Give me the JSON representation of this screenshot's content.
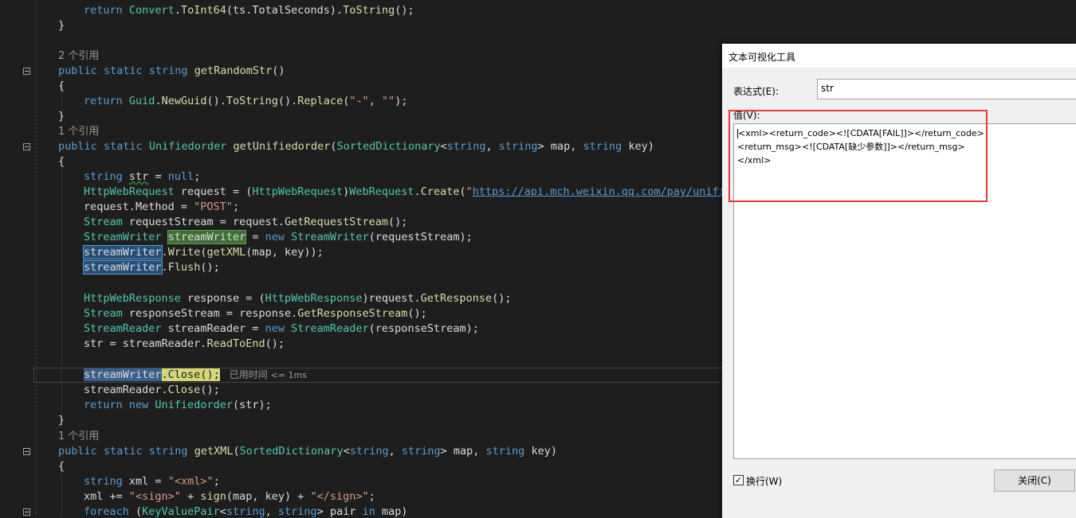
{
  "editor": {
    "refs": {
      "getRandomStr": "2 个引用",
      "getUnifiedorder": "1 个引用",
      "getXML": "1 个引用"
    },
    "perf_tip": {
      "label": "已用时间",
      "value": "<= 1ms"
    },
    "strings": {
      "replace_a": "\"-\"",
      "replace_b": "\"\"",
      "url_open": "\"",
      "url": "https://api.mch.weixin.qq.com/pay/unifiedor",
      "post": "\"POST\"",
      "xml_open": "\"<xml>\"",
      "sign_open": "\"<sign>\"",
      "sign_close": "\"</sign>\""
    }
  },
  "dialog": {
    "title": "文本可视化工具",
    "expression_label": "表达式(E):",
    "expression_value": "str",
    "value_label": "值(V):",
    "value_lines": [
      "<xml><return_code><![CDATA[FAIL]]></return_code>",
      "<return_msg><![CDATA[缺少参数]]></return_msg>",
      "</xml>"
    ],
    "wrap_label": "换行(W)",
    "wrap_checked": true,
    "close_label": "关闭(C)"
  }
}
